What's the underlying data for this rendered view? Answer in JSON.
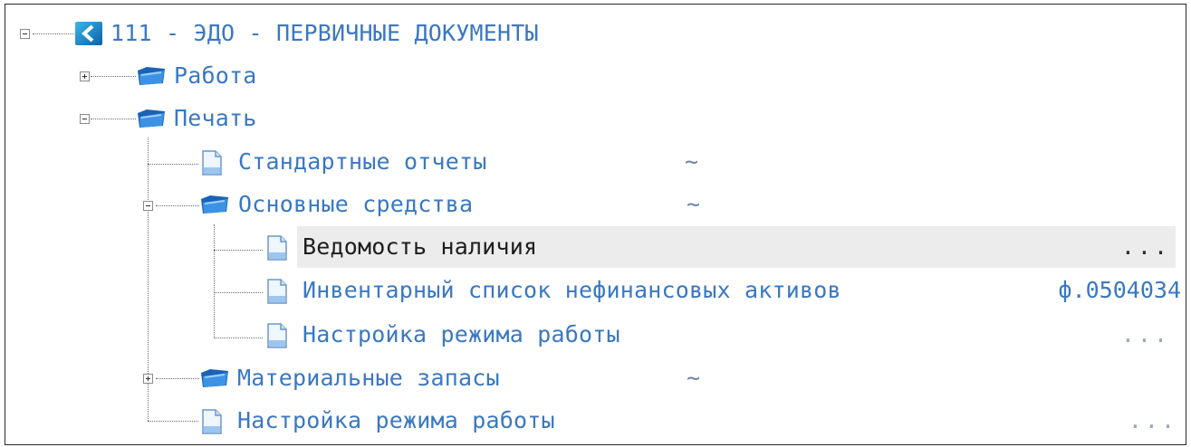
{
  "tree": {
    "root": {
      "label": "111 - ЭДО - ПЕРВИЧНЫЕ ДОКУМЕНТЫ",
      "icon": "module-icon",
      "expanded": true
    },
    "rabota": {
      "label": "Работа",
      "icon": "folder-icon",
      "expanded": false
    },
    "pechat": {
      "label": "Печать",
      "icon": "folder-icon",
      "expanded": true
    },
    "std_reports": {
      "label": "Стандартные отчеты",
      "suffix": "~",
      "icon": "document-icon"
    },
    "osnovnye": {
      "label": "Основные средства",
      "suffix": "~",
      "icon": "folder-icon",
      "expanded": true
    },
    "vedomost": {
      "label": "Ведомость наличия",
      "right": "...",
      "icon": "document-icon",
      "selected": true
    },
    "inventory": {
      "label": "Инвентарный список нефинансовых активов",
      "right": "ф.0504034",
      "icon": "document-icon"
    },
    "mode1": {
      "label": "Настройка режима работы",
      "right": "...",
      "icon": "document-icon"
    },
    "materials": {
      "label": "Материальные запасы",
      "suffix": "~",
      "icon": "folder-icon",
      "expanded": false
    },
    "mode2": {
      "label": "Настройка режима работы",
      "right": "...",
      "icon": "document-icon"
    }
  },
  "colors": {
    "link_text": "#3a78c2",
    "selected_text": "#1d1d1d",
    "selection_bg": "#ececec",
    "tree_lines": "#6b6b6b"
  }
}
